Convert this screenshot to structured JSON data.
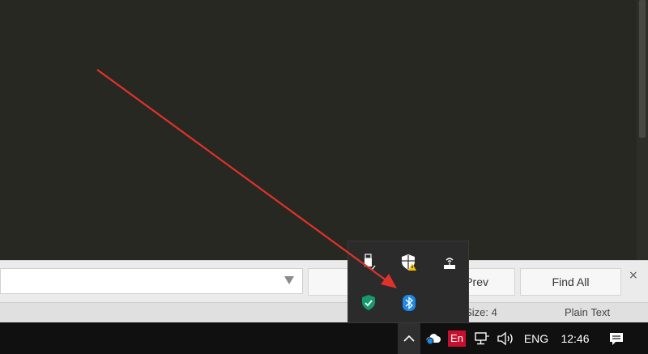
{
  "findbar": {
    "find_prev_label": "Prev",
    "find_all_label": "Find All",
    "close_label": "×"
  },
  "statusbar": {
    "tab_size": "ab Size: 4",
    "syntax": "Plain Text"
  },
  "taskbar": {
    "ime_label": "En",
    "language": "ENG",
    "time": "12:46"
  },
  "tray_overflow": {
    "icons": [
      "usb-safely-remove-icon",
      "windows-security-warning-icon",
      "network-router-icon",
      "security-shield-check-icon",
      "bluetooth-icon"
    ]
  },
  "colors": {
    "editor_bg": "#272822",
    "annotation_arrow": "#e0322b",
    "bluetooth_blue": "#1e88e5"
  }
}
